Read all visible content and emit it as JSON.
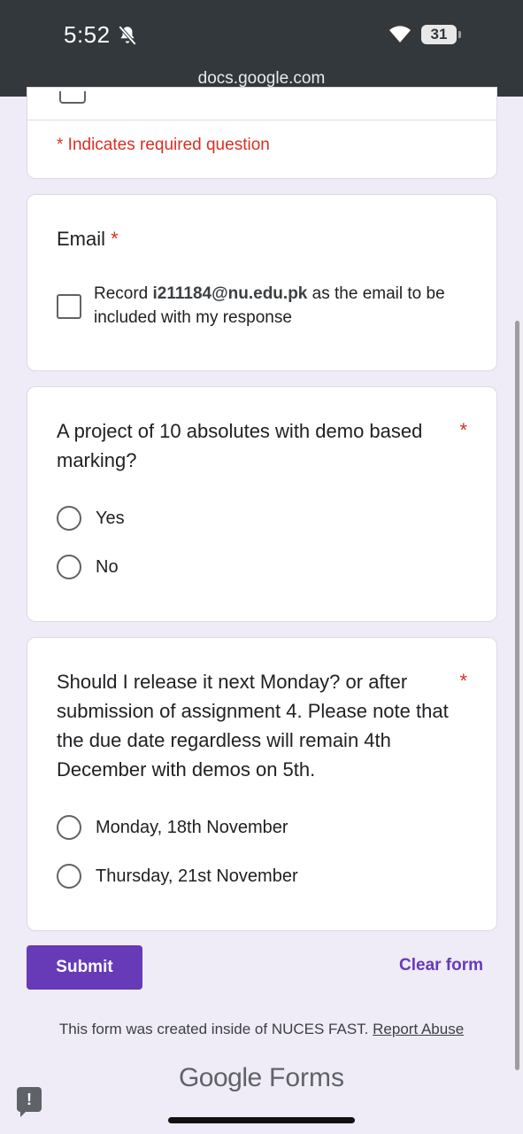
{
  "status_bar": {
    "time": "5:52",
    "battery": "31",
    "url": "docs.google.com"
  },
  "form": {
    "required_note": "* Indicates required question",
    "email_question": {
      "title": "Email",
      "required_mark": "*",
      "record_prefix": "Record",
      "email": "i211184@nu.edu.pk",
      "record_suffix": "as the email to be included with my response"
    },
    "q1": {
      "title": "A project of 10 absolutes with demo based marking?",
      "required_mark": "*",
      "options": [
        "Yes",
        "No"
      ]
    },
    "q2": {
      "title": "Should I release it next Monday? or after submission of assignment 4. Please note that the due date regardless will remain 4th December with demos on 5th.",
      "required_mark": "*",
      "options": [
        "Monday, 18th November",
        "Thursday, 21st November"
      ]
    },
    "submit_label": "Submit",
    "clear_label": "Clear form"
  },
  "footer": {
    "note": "This form was created inside of NUCES FAST.",
    "report_link": "Report Abuse",
    "brand_google": "Google",
    "brand_forms": "Forms"
  },
  "colors": {
    "accent": "#673ab7",
    "required": "#d93025",
    "background": "#efebf7"
  }
}
